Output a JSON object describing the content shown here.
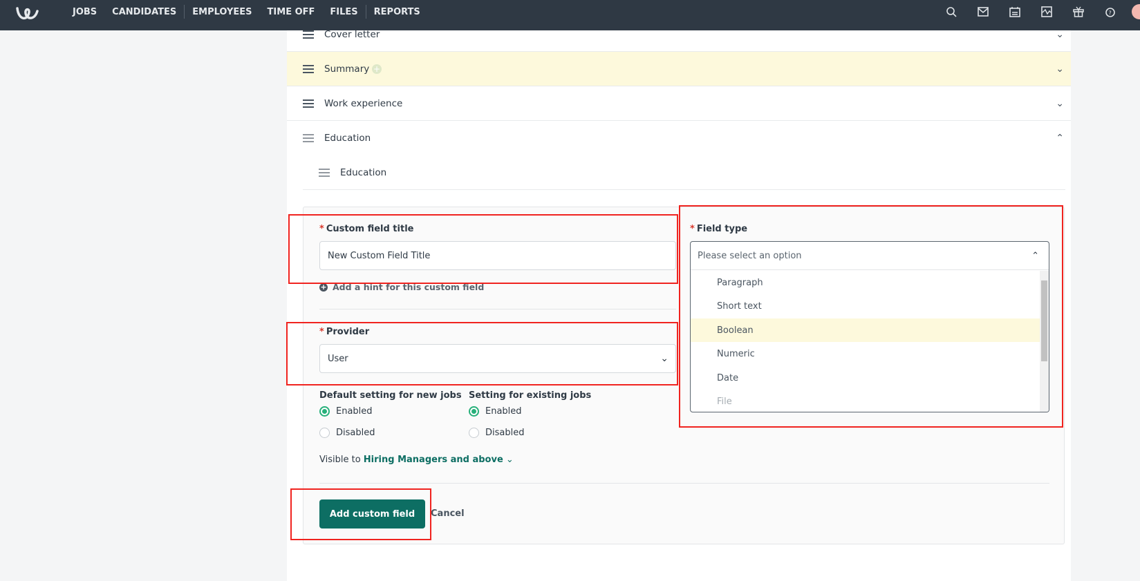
{
  "nav": {
    "items": [
      "JOBS",
      "CANDIDATES",
      "EMPLOYEES",
      "TIME OFF",
      "FILES",
      "REPORTS"
    ]
  },
  "top_icons": [
    "search-icon",
    "mail-icon",
    "calendar-icon",
    "activity-icon",
    "gift-icon",
    "help-icon"
  ],
  "sections": [
    {
      "label": "Cover letter",
      "expanded": false
    },
    {
      "label": "Summary",
      "expanded": false,
      "highlighted": true
    },
    {
      "label": "Work experience",
      "expanded": false
    },
    {
      "label": "Education",
      "expanded": true
    }
  ],
  "subsection": {
    "label": "Education"
  },
  "form": {
    "title_label": "Custom field title",
    "title_value": "New Custom Field Title",
    "hint_link": "Add a hint for this custom field",
    "provider_label": "Provider",
    "provider_value": "User",
    "new_jobs_label": "Default setting for new jobs",
    "existing_jobs_label": "Setting for existing jobs",
    "enabled": "Enabled",
    "disabled": "Disabled",
    "visible_prefix": "Visible to",
    "visible_value": "Hiring Managers and above",
    "field_type_label": "Field type",
    "field_type_placeholder": "Please select an option",
    "field_type_options": [
      "Paragraph",
      "Short text",
      "Boolean",
      "Numeric",
      "Date",
      "File"
    ],
    "highlighted_option": "Boolean",
    "submit": "Add custom field",
    "cancel": "Cancel"
  },
  "colors": {
    "topbar": "#2f3944",
    "accent": "#0d6e63",
    "radio": "#27b07a",
    "highlight": "#fdf9dc",
    "annotation": "#f0231f"
  }
}
